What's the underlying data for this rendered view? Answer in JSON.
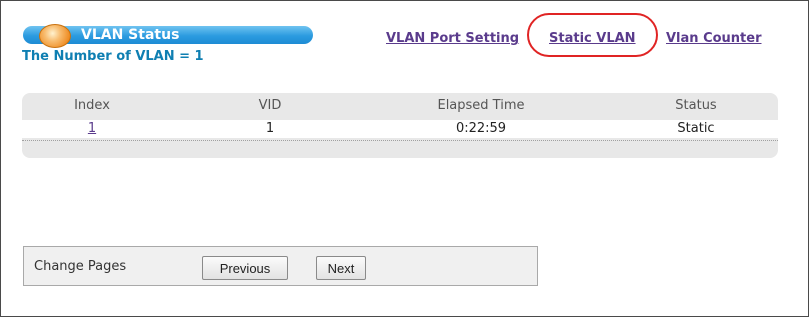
{
  "header": {
    "title": "VLAN Status",
    "vlan_count_text": "The Number of VLAN = 1"
  },
  "nav_links": {
    "port_setting": "VLAN Port Setting",
    "static_vlan": "Static VLAN",
    "vlan_counter": "Vlan Counter"
  },
  "table": {
    "columns": [
      "Index",
      "VID",
      "Elapsed Time",
      "Status"
    ],
    "rows": [
      {
        "index": "1",
        "vid": "1",
        "elapsed": "0:22:59",
        "status": "Static"
      }
    ]
  },
  "pager": {
    "label": "Change Pages",
    "previous": "Previous",
    "next": "Next"
  },
  "colors": {
    "title_pill": "#2b9be0",
    "link": "#5a3b8c",
    "highlight": "#e02424",
    "count_text": "#0f7fb2"
  }
}
